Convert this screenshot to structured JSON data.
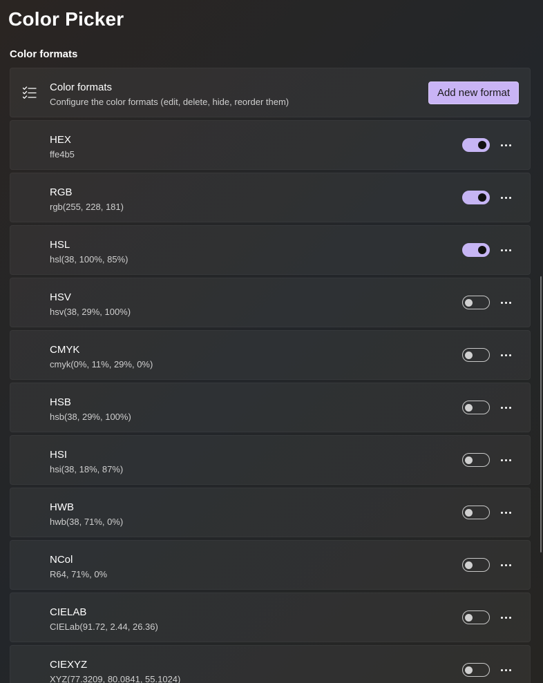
{
  "page": {
    "title": "Color Picker",
    "section_title": "Color formats"
  },
  "header_card": {
    "title": "Color formats",
    "description": "Configure the color formats (edit, delete, hide, reorder them)",
    "add_button_label": "Add new format",
    "icon": "checklist-icon"
  },
  "formats": [
    {
      "name": "HEX",
      "value": "ffe4b5",
      "enabled": true
    },
    {
      "name": "RGB",
      "value": "rgb(255, 228, 181)",
      "enabled": true
    },
    {
      "name": "HSL",
      "value": "hsl(38, 100%, 85%)",
      "enabled": true
    },
    {
      "name": "HSV",
      "value": "hsv(38, 29%, 100%)",
      "enabled": false
    },
    {
      "name": "CMYK",
      "value": "cmyk(0%, 11%, 29%, 0%)",
      "enabled": false
    },
    {
      "name": "HSB",
      "value": "hsb(38, 29%, 100%)",
      "enabled": false
    },
    {
      "name": "HSI",
      "value": "hsi(38, 18%, 87%)",
      "enabled": false
    },
    {
      "name": "HWB",
      "value": "hwb(38, 71%, 0%)",
      "enabled": false
    },
    {
      "name": "NCol",
      "value": "R64, 71%, 0%",
      "enabled": false
    },
    {
      "name": "CIELAB",
      "value": "CIELab(91.72, 2.44, 26.36)",
      "enabled": false
    },
    {
      "name": "CIEXYZ",
      "value": "XYZ(77.3209, 80.0841, 55.1024)",
      "enabled": false
    }
  ],
  "colors": {
    "accent": "#c6b5f4",
    "card_background": "rgba(255,255,255,0.05)"
  }
}
